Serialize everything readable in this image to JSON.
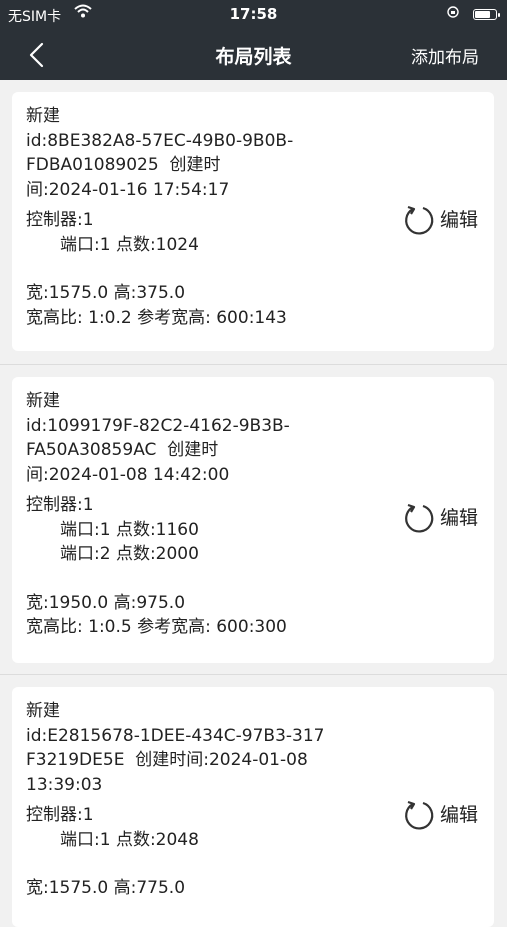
{
  "status_bar": {
    "carrier": "无SIM卡",
    "time": "17:58",
    "battery_level": 0.85
  },
  "nav": {
    "title": "布局列表",
    "add_label": "添加布局",
    "back_icon": "chevron-left-icon"
  },
  "layouts": [
    {
      "name": "新建",
      "id_lines": [
        "id:8BE382A8-57EC-49B0-9B0B-",
        "FDBA01089025  创建时",
        "间:2024-01-16 17:54:17"
      ],
      "controller": "控制器:1",
      "ports": [
        "端口:1 点数:1024"
      ],
      "size": "宽:1575.0 高:375.0",
      "ratio": "宽高比: 1:0.2 参考宽高: 600:143",
      "edit_label": "编辑"
    },
    {
      "name": "新建",
      "id_lines": [
        "id:1099179F-82C2-4162-9B3B-",
        "FA50A30859AC  创建时",
        "间:2024-01-08 14:42:00"
      ],
      "controller": "控制器:1",
      "ports": [
        "端口:1 点数:1160",
        "端口:2 点数:2000"
      ],
      "size": "宽:1950.0 高:975.0",
      "ratio": "宽高比: 1:0.5 参考宽高: 600:300",
      "edit_label": "编辑"
    },
    {
      "name": "新建",
      "id_lines": [
        "id:E2815678-1DEE-434C-97B3-317",
        "F3219DE5E  创建时间:2024-01-08",
        "13:39:03"
      ],
      "controller": "控制器:1",
      "ports": [
        "端口:1 点数:2048"
      ],
      "size": "宽:1575.0 高:775.0",
      "ratio": "",
      "edit_label": "编辑"
    }
  ]
}
